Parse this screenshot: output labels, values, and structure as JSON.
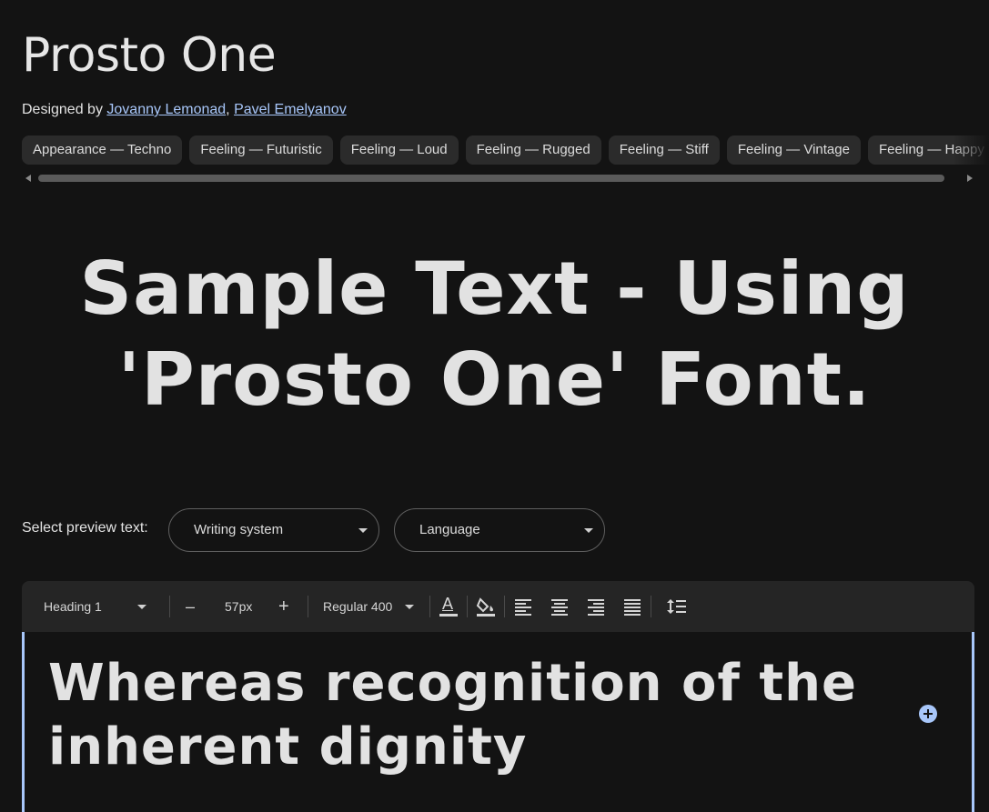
{
  "font": {
    "name": "Prosto One",
    "designed_by_label": "Designed by",
    "designers": [
      "Jovanny Lemonad",
      "Pavel Emelyanov"
    ],
    "designer_separator": ","
  },
  "tags": [
    "Appearance — Techno",
    "Feeling — Futuristic",
    "Feeling — Loud",
    "Feeling — Rugged",
    "Feeling — Stiff",
    "Feeling — Vintage",
    "Feeling — Happy"
  ],
  "sample_text": "Sample Text - Using 'Prosto One' Font.",
  "preview_select": {
    "label": "Select preview text:",
    "writing_system": "Writing system",
    "language": "Language"
  },
  "toolbar": {
    "style": "Heading 1",
    "decrease": "–",
    "size": "57px",
    "increase": "+",
    "weight": "Regular 400",
    "text_color_glyph": "A"
  },
  "icons": {
    "text_color": "text-color-icon",
    "highlight": "highlight-fill-icon",
    "align_left": "align-left-icon",
    "align_center": "align-center-icon",
    "align_right": "align-right-icon",
    "align_justify": "align-justify-icon",
    "line_height": "line-height-icon",
    "add": "add-circle-icon"
  },
  "editor_text": "Whereas recognition of the inherent dignity",
  "colors": {
    "background": "#131313",
    "accent": "#a8c7fa",
    "chip": "#2b2b2b",
    "toolbar": "#252525"
  }
}
